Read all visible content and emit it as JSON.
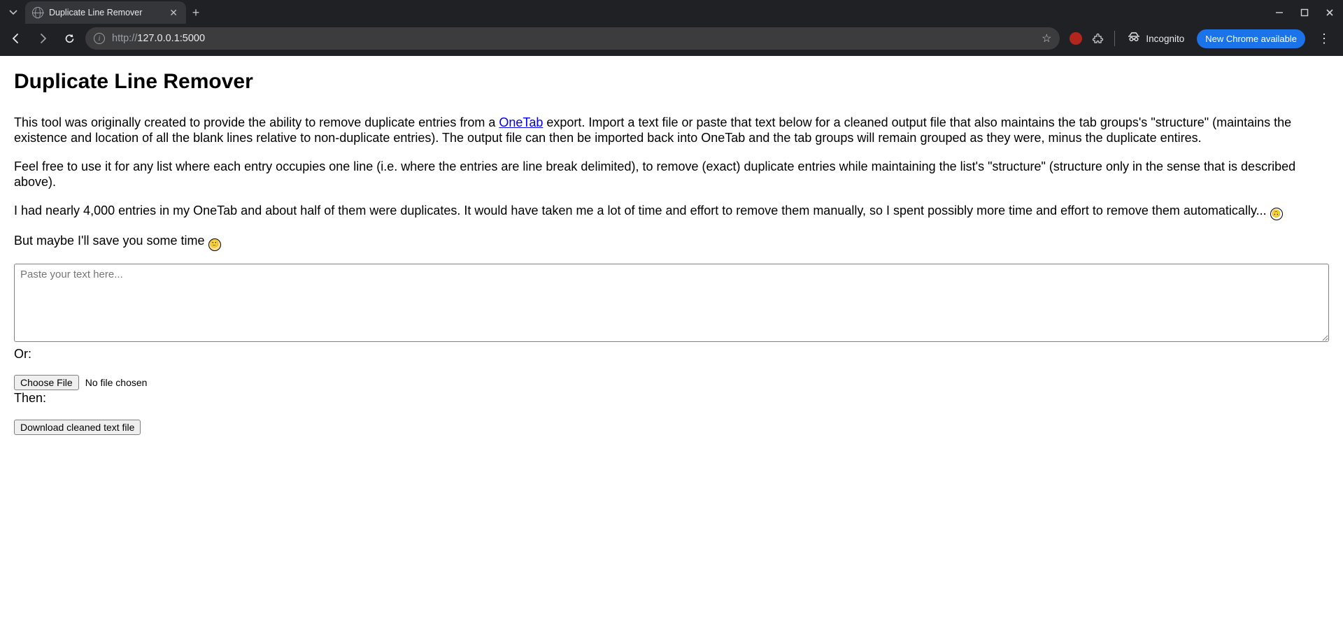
{
  "browser": {
    "tab_title": "Duplicate Line Remover",
    "url_scheme": "http://",
    "url_rest": "127.0.0.1:5000",
    "incognito_label": "Incognito",
    "update_label": "New Chrome available"
  },
  "page": {
    "heading": "Duplicate Line Remover",
    "intro_part1": "This tool was originally created to provide the ability to remove duplicate entries from a ",
    "link_text": "OneTab",
    "intro_part2": " export. Import a text file or paste that text below for a cleaned output file that also maintains the tab groups's \"structure\" (maintains the existence and location of all the blank lines relative to non-duplicate entries). The output file can then be imported back into OneTab and the tab groups will remain grouped as they were, minus the duplicate entires.",
    "para2": "Feel free to use it for any list where each entry occupies one line (i.e. where the entries are line break delimited), to remove (exact) duplicate entries while maintaining the list's \"structure\" (structure only in the sense that is described above).",
    "para3_pre": "I had nearly 4,000 entries in my OneTab and about half of them were duplicates. It would have taken me a lot of time and effort to remove them manually, so I spent possibly more time and effort to remove them automatically... ",
    "para4_pre": "But maybe I'll save you some time ",
    "textarea_placeholder": "Paste your text here...",
    "or_label": "Or:",
    "choose_file_label": "Choose File",
    "no_file_label": "No file chosen",
    "then_label": "Then:",
    "download_label": "Download cleaned text file"
  }
}
